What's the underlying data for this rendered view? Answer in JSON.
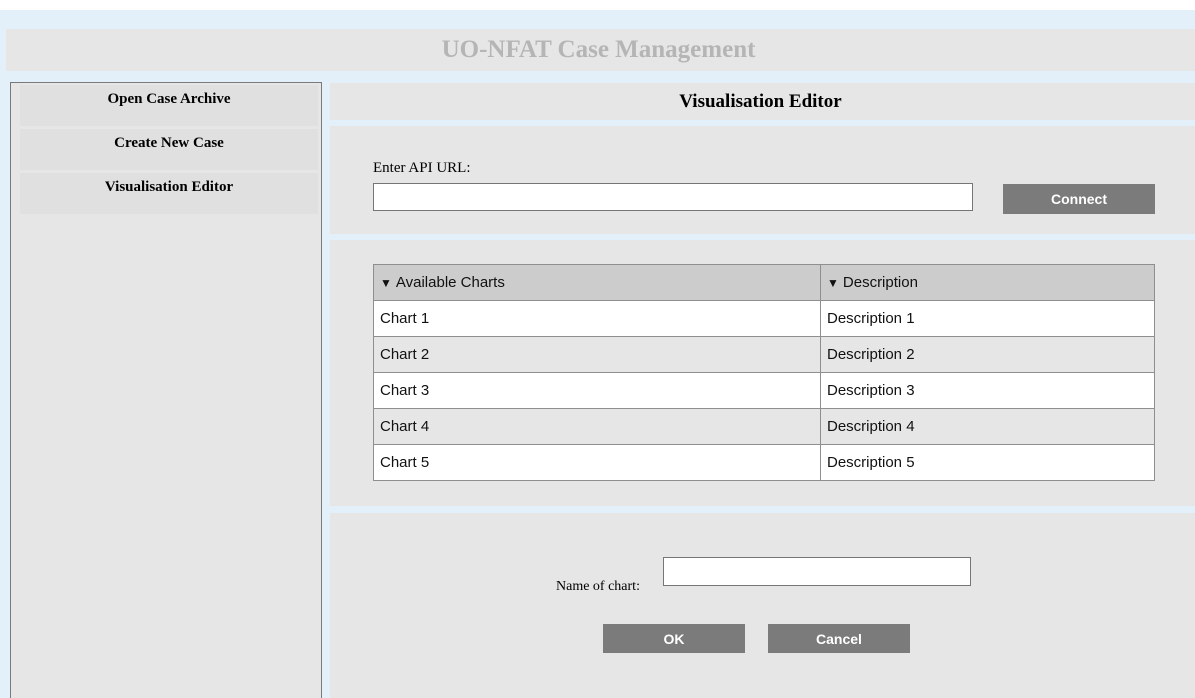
{
  "header": {
    "title": "UO-NFAT Case Management"
  },
  "sidebar": {
    "items": [
      {
        "label": "Open Case Archive"
      },
      {
        "label": "Create New Case"
      },
      {
        "label": "Visualisation Editor"
      }
    ]
  },
  "editor": {
    "title": "Visualisation Editor"
  },
  "api": {
    "label": "Enter API URL:",
    "value": "",
    "connect_label": "Connect"
  },
  "charts_table": {
    "columns": [
      "Available Charts",
      "Description"
    ],
    "sort_icon": "caret-down-icon",
    "rows": [
      [
        "Chart 1",
        "Description 1"
      ],
      [
        "Chart 2",
        "Description 2"
      ],
      [
        "Chart 3",
        "Description 3"
      ],
      [
        "Chart 4",
        "Description 4"
      ],
      [
        "Chart 5",
        "Description 5"
      ]
    ]
  },
  "name_form": {
    "label": "Name of chart:",
    "value": "",
    "ok_label": "OK",
    "cancel_label": "Cancel"
  },
  "colors": {
    "accent_band": "#e3f0fa",
    "panel": "#e6e6e6",
    "button": "#7b7b7b",
    "header_text": "#b5b5b5"
  }
}
